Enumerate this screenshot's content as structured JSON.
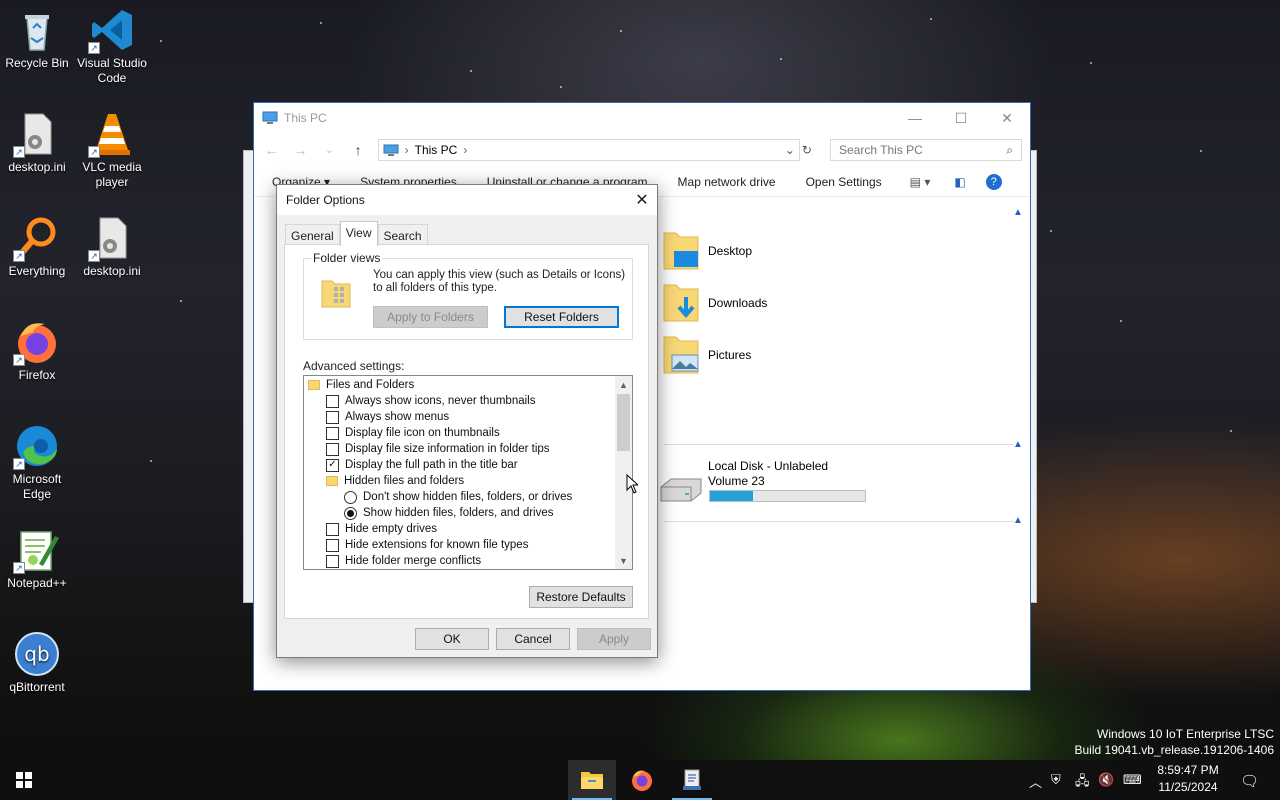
{
  "desktop": {
    "icons": [
      {
        "label": "Recycle Bin"
      },
      {
        "label": "Visual Studio Code"
      },
      {
        "label": "desktop.ini"
      },
      {
        "label": "VLC media player"
      },
      {
        "label": "Everything"
      },
      {
        "label": "desktop.ini"
      },
      {
        "label": "Firefox"
      },
      {
        "label": "Microsoft Edge"
      },
      {
        "label": "Notepad++"
      },
      {
        "label": "qBittorrent"
      }
    ]
  },
  "explorer": {
    "title": "This PC",
    "address": "This PC",
    "search_placeholder": "Search This PC",
    "toolbar": [
      "Organize ▾",
      "System properties",
      "Uninstall or change a program",
      "Map network drive",
      "Open Settings"
    ],
    "folders": [
      {
        "label": "Desktop"
      },
      {
        "label": "Downloads"
      },
      {
        "label": "Pictures"
      }
    ],
    "drive": {
      "name": "Local Disk - Unlabeled",
      "volume": "Volume 23",
      "used_fraction": 0.28
    }
  },
  "dialog": {
    "title": "Folder Options",
    "tabs": [
      "General",
      "View",
      "Search"
    ],
    "active_tab": "View",
    "folder_views": {
      "label": "Folder views",
      "text": "You can apply this view (such as Details or Icons) to all folders of this type.",
      "apply_button": "Apply to Folders",
      "reset_button": "Reset Folders"
    },
    "advanced_label": "Advanced settings:",
    "settings": [
      {
        "kind": "folder",
        "label": "Files and Folders",
        "indent": 0
      },
      {
        "kind": "checkbox",
        "label": "Always show icons, never thumbnails",
        "checked": false,
        "indent": 1
      },
      {
        "kind": "checkbox",
        "label": "Always show menus",
        "checked": false,
        "indent": 1
      },
      {
        "kind": "checkbox",
        "label": "Display file icon on thumbnails",
        "checked": false,
        "indent": 1
      },
      {
        "kind": "checkbox",
        "label": "Display file size information in folder tips",
        "checked": false,
        "indent": 1
      },
      {
        "kind": "checkbox",
        "label": "Display the full path in the title bar",
        "checked": true,
        "indent": 1
      },
      {
        "kind": "folder",
        "label": "Hidden files and folders",
        "indent": 1
      },
      {
        "kind": "radio",
        "label": "Don't show hidden files, folders, or drives",
        "checked": false,
        "indent": 2
      },
      {
        "kind": "radio",
        "label": "Show hidden files, folders, and drives",
        "checked": true,
        "indent": 2
      },
      {
        "kind": "checkbox",
        "label": "Hide empty drives",
        "checked": false,
        "indent": 1
      },
      {
        "kind": "checkbox",
        "label": "Hide extensions for known file types",
        "checked": false,
        "indent": 1
      },
      {
        "kind": "checkbox",
        "label": "Hide folder merge conflicts",
        "checked": false,
        "indent": 1
      }
    ],
    "restore_defaults": "Restore Defaults",
    "ok": "OK",
    "cancel": "Cancel",
    "apply": "Apply"
  },
  "system": {
    "watermark_line1": "Windows 10 IoT Enterprise LTSC",
    "watermark_line2": "Build 19041.vb_release.191206-1406",
    "time": "8:59:47 PM",
    "date": "11/25/2024"
  }
}
